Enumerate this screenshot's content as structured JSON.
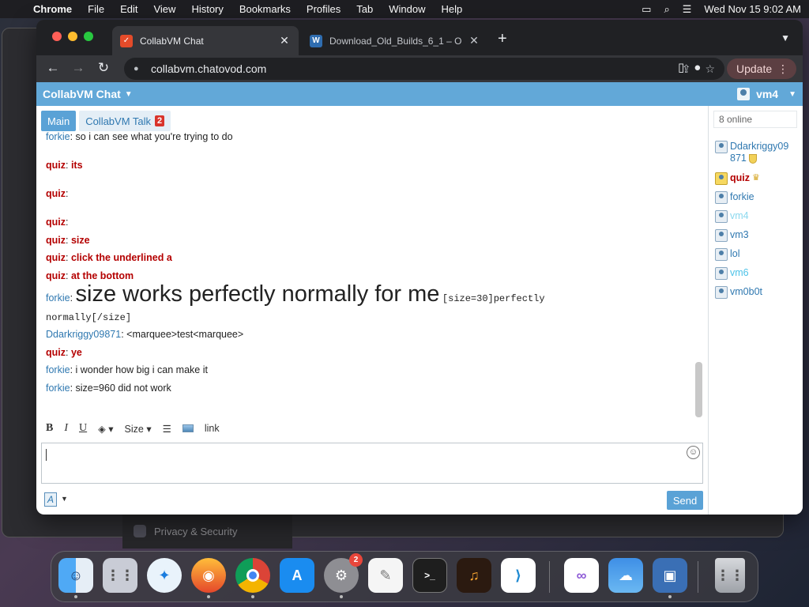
{
  "menubar": {
    "app": "Chrome",
    "items": [
      "File",
      "Edit",
      "View",
      "History",
      "Bookmarks",
      "Profiles",
      "Tab",
      "Window",
      "Help"
    ],
    "datetime": "Wed Nov 15  9:02 AM"
  },
  "browser": {
    "tabs": [
      {
        "title": "CollabVM Chat",
        "favicon": "collabvm-icon",
        "active": true
      },
      {
        "title": "Download_Old_Builds_6_1 – O",
        "favicon": "wiki-icon",
        "active": false
      }
    ],
    "url": "collabvm.chatovod.com",
    "update_label": "Update"
  },
  "chat": {
    "app_title": "CollabVM Chat",
    "current_user": "vm4",
    "tabs": [
      {
        "label": "Main",
        "active": true
      },
      {
        "label": "CollabVM Talk",
        "badge": "2",
        "active": false
      }
    ],
    "messages": [
      {
        "nick": "forkie",
        "text": "so i can see what you're trying to do",
        "style": "normal"
      },
      {
        "nick": "quiz",
        "text": "its",
        "style": "red"
      },
      {
        "nick": "quiz",
        "text": "",
        "style": "red"
      },
      {
        "nick": "quiz",
        "text": "",
        "style": "red"
      },
      {
        "nick": "quiz",
        "text": "size",
        "style": "red"
      },
      {
        "nick": "quiz",
        "text": "click the underlined a",
        "style": "red"
      },
      {
        "nick": "quiz",
        "text": "at the bottom",
        "style": "red"
      },
      {
        "nick": "forkie",
        "text_big": "size works perfectly normally for me",
        "text_code": "[size=30]perfectly",
        "text_code2": "normally[/size]",
        "style": "big"
      },
      {
        "nick": "Ddarkriggy09871",
        "text": "<marquee>test<marquee>",
        "style": "normal"
      },
      {
        "nick": "quiz",
        "text": "ye",
        "style": "red"
      },
      {
        "nick": "forkie",
        "text": "i wonder how big i can make it",
        "style": "normal"
      },
      {
        "nick": "forkie",
        "text": "size=960 did not work",
        "style": "normal"
      }
    ],
    "toolbar": {
      "bold": "B",
      "italic": "I",
      "underline": "U",
      "size": "Size",
      "link": "link"
    },
    "format_button": "A",
    "send_label": "Send",
    "online_count": "8 online",
    "users": [
      {
        "name": "Ddarkriggy09871",
        "name_line1": "Ddarkriggy09",
        "name_line2": "871",
        "role": "mod"
      },
      {
        "name": "quiz",
        "role": "admin"
      },
      {
        "name": "forkie",
        "role": "user"
      },
      {
        "name": "vm4",
        "role": "self"
      },
      {
        "name": "vm3",
        "role": "user"
      },
      {
        "name": "lol",
        "role": "user"
      },
      {
        "name": "vm6",
        "role": "cyan"
      },
      {
        "name": "vm0b0t",
        "role": "user"
      }
    ]
  },
  "background": {
    "settings_item": "Privacy & Security"
  },
  "dock": {
    "apps": [
      "finder-icon",
      "launchpad-icon",
      "safari-icon",
      "firefox-icon",
      "chrome-icon",
      "app-store-icon",
      "system-settings-icon",
      "textedit-icon",
      "terminal-icon",
      "garageband-icon",
      "vscode-icon",
      "visual-studio-icon",
      "weather-icon",
      "virtualbox-icon",
      "trash-icon"
    ],
    "settings_badge": "2"
  },
  "colors": {
    "accent": "#62a8d8",
    "admin_red": "#b40000",
    "link_blue": "#2f78b0"
  }
}
